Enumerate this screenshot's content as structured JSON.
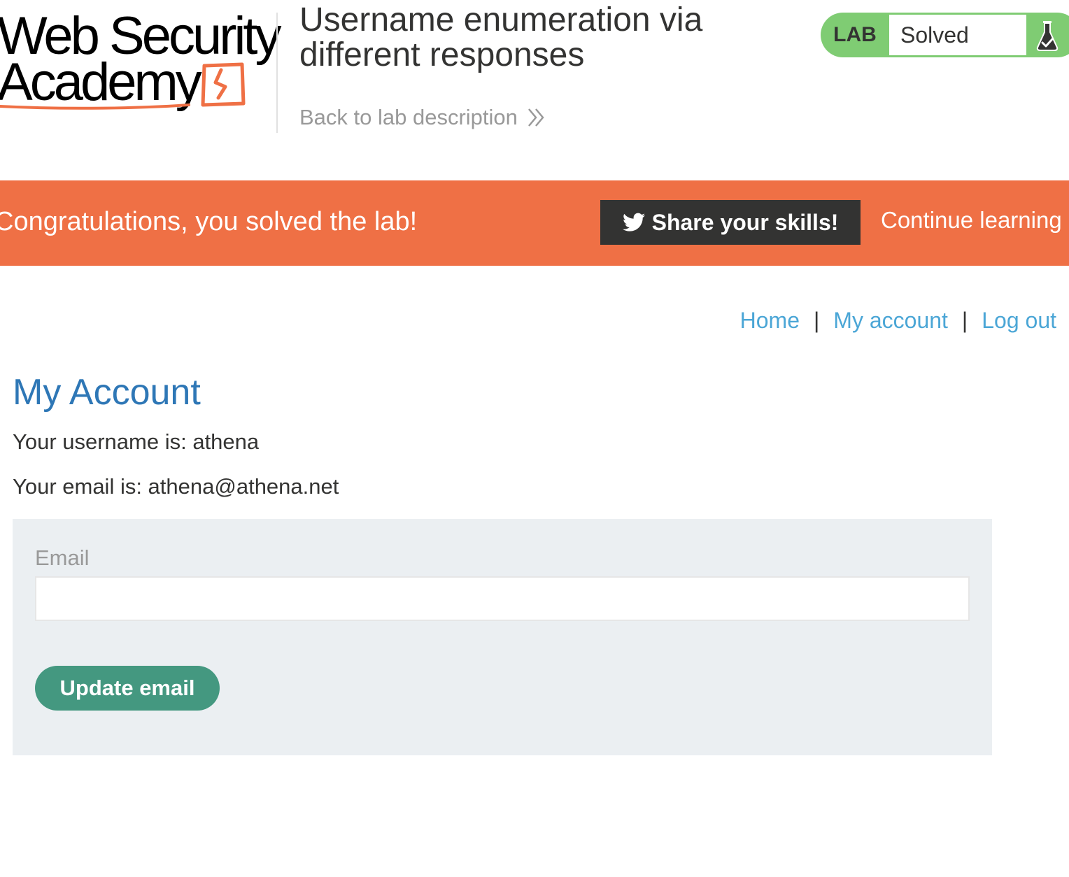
{
  "header": {
    "logo": {
      "line1": "Web Security",
      "line2": "Academy"
    },
    "lab_title": "Username enumeration via different responses",
    "back_link": "Back to lab description",
    "status": {
      "badge": "LAB",
      "text": "Solved"
    }
  },
  "banner": {
    "message": "Congratulations, you solved the lab!",
    "share_button": "Share your skills!",
    "continue_link": "Continue learning"
  },
  "nav": {
    "items": [
      {
        "label": "Home"
      },
      {
        "label": "My account"
      },
      {
        "label": "Log out"
      }
    ],
    "separator": "|"
  },
  "account": {
    "title": "My Account",
    "username_line": "Your username is: athena",
    "email_line": "Your email is: athena@athena.net"
  },
  "form": {
    "email_label": "Email",
    "email_value": "",
    "submit_label": "Update email"
  },
  "colors": {
    "banner": "#ef7045",
    "solved_badge": "#7fcc73",
    "title_blue": "#2e77b6",
    "link_blue": "#4ba6d6",
    "button_green": "#449880",
    "panel_bg": "#ebeff2"
  },
  "icons": [
    "twitter-icon",
    "double-chevron-right-icon",
    "chevron-right-icon",
    "flask-icon"
  ]
}
